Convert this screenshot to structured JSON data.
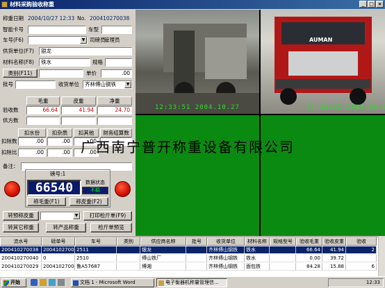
{
  "window": {
    "title": "材料采购验收称重"
  },
  "form": {
    "weigh_date_label": "称重日期",
    "weigh_date_value": "2004/10/27 12:33",
    "no_label": "No.",
    "no_value": "200410270038",
    "smartcard_label": "智能卡号",
    "vehicle_type_label": "车型",
    "plate_label": "车号(F6)",
    "operator_label": "司磅员",
    "operator_value": "管理员",
    "supplier_label": "供货单位(F7)",
    "supplier_value": "银龙",
    "material_label": "材料名称(F8)",
    "material_value": "铁水",
    "spec_label": "规格",
    "category_label": "类别(F11)",
    "unit_price_label": "单价",
    "unit_price_value": ".00",
    "batch_label": "批号",
    "receiver_label": "收货单位",
    "receiver_value": "齐林傅山钢铁"
  },
  "weights": {
    "col_gross": "毛重",
    "col_tare": "皮重",
    "col_net": "净重",
    "row_accept": "验收数",
    "row_supply": "供方数",
    "accept_gross": "66.64",
    "accept_tare": "41.94",
    "accept_net": "24.70",
    "supply_gross": "",
    "supply_tare": "",
    "supply_net": ""
  },
  "deduct": {
    "col1": "扣水份",
    "col2": "扣杂质",
    "col3": "扣其他",
    "col4": "财务结算数",
    "row1": "扣除数",
    "row2": "扣除比",
    "v1": ".00",
    "v2": ".00",
    "v3": ".00",
    "v4": "",
    "p1": ".00",
    "p2": ".00",
    "p3": ".00"
  },
  "remarks_label": "备注：",
  "scale": {
    "scale_no": "磅号:1",
    "reading": "66540",
    "status_label": "数据状态",
    "status_value": "不稳",
    "gross_btn": "称毛重(F1)",
    "tare_btn": "称皮重(F2)"
  },
  "buttons": {
    "preset_tare": "转预称皮重",
    "print_slip": "打印检斤单(F9)",
    "transfer_other": "转其它称重",
    "transfer_product": "转产品称重",
    "preview_slip": "检斤单预览"
  },
  "cameras": {
    "cam1_timestamp": "12:33:51 2004.10.27",
    "cam2_timestamp": "12:33:52 2004.10.27",
    "truck_brand": "AUMAN"
  },
  "watermark": "广西南宁普开称重设备有限公司",
  "table": {
    "headers": [
      "流水号",
      "磅单号",
      "车号",
      "类别",
      "供应商名称",
      "批号",
      "收货单位",
      "材料名称",
      "规格型号",
      "验收毛重",
      "验收皮重",
      "验收"
    ],
    "rows": [
      [
        "200410270038",
        "200410270043",
        "2511",
        "",
        "银龙",
        "",
        "齐林傅山钢铁",
        "铁水",
        "",
        "66.64",
        "41.94",
        "2"
      ],
      [
        "200410270040",
        "0",
        "2510",
        "",
        "傅山铁厂",
        "",
        "齐林傅山钢铁",
        "铁水",
        "",
        "0.00",
        "39.72",
        ""
      ],
      [
        "200410270029",
        "200410270042",
        "鲁A57687",
        "",
        "博湘",
        "",
        "齐林傅山钢铁",
        "面包铁",
        "",
        "84.28",
        "15.88",
        "6"
      ]
    ]
  },
  "taskbar": {
    "start": "开始",
    "item1": "文档 1 - Microsoft Word",
    "item2": "电子衡器机称量管理信...",
    "clock": "12:33"
  },
  "colors": {
    "title_blue": "#0a246a",
    "display_bg": "#0a1a6a",
    "cam_green": "#0a8a10",
    "timestamp_green": "#28e028",
    "light_red": "#d41000"
  }
}
